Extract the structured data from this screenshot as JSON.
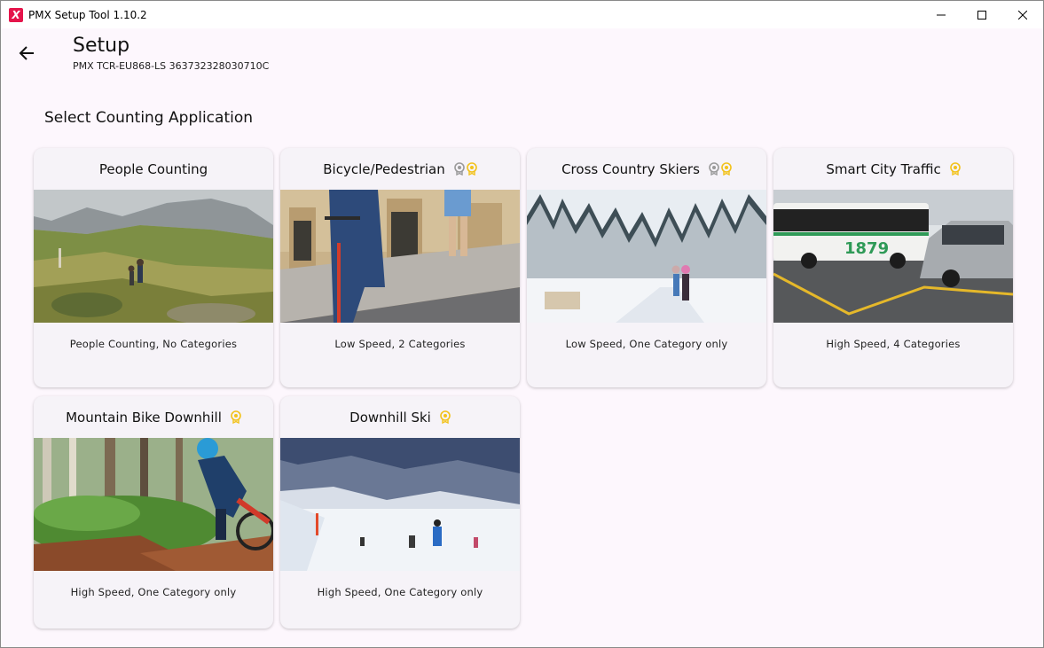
{
  "window": {
    "title": "PMX Setup Tool 1.10.2",
    "app_icon_letter": "X",
    "controls": [
      "minimize",
      "maximize",
      "close"
    ]
  },
  "header": {
    "title": "Setup",
    "subtitle": "PMX TCR-EU868-LS 363732328030710C"
  },
  "section_title": "Select Counting Application",
  "colors": {
    "background": "#fdf7fd",
    "card": "#f6f3f8",
    "badge_gold": "#f2c21b",
    "badge_silver": "#9a9a9a",
    "brand": "#e5154b"
  },
  "cards": [
    {
      "title": "People Counting",
      "description": "People Counting, No Categories",
      "badges": [],
      "image": "mountain-hikers"
    },
    {
      "title": "Bicycle/Pedestrian",
      "description": "Low Speed, 2 Categories",
      "badges": [
        "silver",
        "gold"
      ],
      "image": "scooter-street"
    },
    {
      "title": "Cross Country Skiers",
      "description": "Low Speed, One Category only",
      "badges": [
        "silver",
        "gold"
      ],
      "image": "snowy-forest-skiers"
    },
    {
      "title": "Smart City Traffic",
      "description": "High Speed, 4 Categories",
      "badges": [
        "gold"
      ],
      "image": "bus-and-car"
    },
    {
      "title": "Mountain Bike Downhill",
      "description": "High Speed, One Category only",
      "badges": [
        "gold"
      ],
      "image": "mountain-biker"
    },
    {
      "title": "Downhill Ski",
      "description": "High Speed, One Category only",
      "badges": [
        "gold"
      ],
      "image": "ski-slope"
    }
  ]
}
